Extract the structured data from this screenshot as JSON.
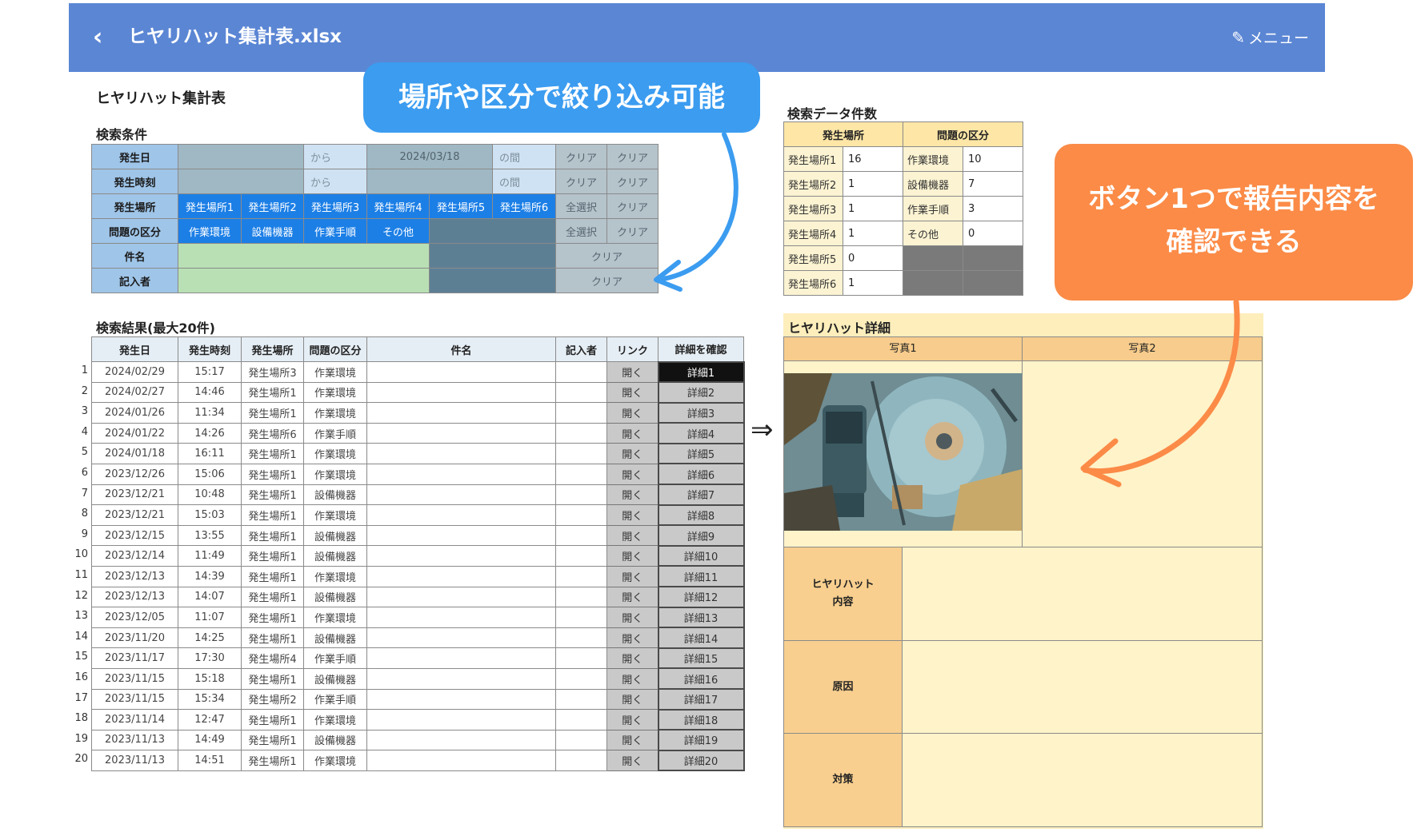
{
  "header": {
    "title": "ヒヤリハット集計表.xlsx",
    "menu_label": "メニュー"
  },
  "sheet": {
    "title": "ヒヤリハット集計表"
  },
  "search": {
    "section_label": "検索条件",
    "rows": {
      "date": {
        "label": "発生日",
        "from": "から",
        "to_value": "2024/03/18",
        "between": "の間",
        "clear1": "クリア",
        "clear2": "クリア"
      },
      "time": {
        "label": "発生時刻",
        "from": "から",
        "between": "の間",
        "clear1": "クリア",
        "clear2": "クリア"
      },
      "place": {
        "label": "発生場所",
        "buttons": [
          "発生場所1",
          "発生場所2",
          "発生場所3",
          "発生場所4",
          "発生場所5",
          "発生場所6"
        ],
        "select_all": "全選択",
        "clear": "クリア"
      },
      "category": {
        "label": "問題の区分",
        "buttons": [
          "作業環境",
          "設備機器",
          "作業手順",
          "その他"
        ],
        "select_all": "全選択",
        "clear": "クリア"
      },
      "subject": {
        "label": "件名",
        "clear": "クリア"
      },
      "author": {
        "label": "記入者",
        "clear": "クリア"
      }
    }
  },
  "counts": {
    "section_label": "検索データ件数",
    "headers": [
      "発生場所",
      "問題の区分"
    ],
    "places": [
      {
        "name": "発生場所1",
        "count": "16"
      },
      {
        "name": "発生場所2",
        "count": "1"
      },
      {
        "name": "発生場所3",
        "count": "1"
      },
      {
        "name": "発生場所4",
        "count": "1"
      },
      {
        "name": "発生場所5",
        "count": "0"
      },
      {
        "name": "発生場所6",
        "count": "1"
      }
    ],
    "categories": [
      {
        "name": "作業環境",
        "count": "10"
      },
      {
        "name": "設備機器",
        "count": "7"
      },
      {
        "name": "作業手順",
        "count": "3"
      },
      {
        "name": "その他",
        "count": "0"
      }
    ]
  },
  "results": {
    "section_label": "検索結果(最大20件)",
    "headers": [
      "発生日",
      "発生時刻",
      "発生場所",
      "問題の区分",
      "件名",
      "記入者",
      "リンク",
      "詳細を確認"
    ],
    "open_label": "開く",
    "rows": [
      {
        "no": "1",
        "date": "2024/02/29",
        "time": "15:17",
        "place": "発生場所3",
        "category": "作業環境",
        "detail": "詳細1"
      },
      {
        "no": "2",
        "date": "2024/02/27",
        "time": "14:46",
        "place": "発生場所1",
        "category": "作業環境",
        "detail": "詳細2"
      },
      {
        "no": "3",
        "date": "2024/01/26",
        "time": "11:34",
        "place": "発生場所1",
        "category": "作業環境",
        "detail": "詳細3"
      },
      {
        "no": "4",
        "date": "2024/01/22",
        "time": "14:26",
        "place": "発生場所6",
        "category": "作業手順",
        "detail": "詳細4"
      },
      {
        "no": "5",
        "date": "2024/01/18",
        "time": "16:11",
        "place": "発生場所1",
        "category": "作業環境",
        "detail": "詳細5"
      },
      {
        "no": "6",
        "date": "2023/12/26",
        "time": "15:06",
        "place": "発生場所1",
        "category": "作業環境",
        "detail": "詳細6"
      },
      {
        "no": "7",
        "date": "2023/12/21",
        "time": "10:48",
        "place": "発生場所1",
        "category": "設備機器",
        "detail": "詳細7"
      },
      {
        "no": "8",
        "date": "2023/12/21",
        "time": "15:03",
        "place": "発生場所1",
        "category": "作業環境",
        "detail": "詳細8"
      },
      {
        "no": "9",
        "date": "2023/12/15",
        "time": "13:55",
        "place": "発生場所1",
        "category": "設備機器",
        "detail": "詳細9"
      },
      {
        "no": "10",
        "date": "2023/12/14",
        "time": "11:49",
        "place": "発生場所1",
        "category": "設備機器",
        "detail": "詳細10"
      },
      {
        "no": "11",
        "date": "2023/12/13",
        "time": "14:39",
        "place": "発生場所1",
        "category": "作業環境",
        "detail": "詳細11"
      },
      {
        "no": "12",
        "date": "2023/12/13",
        "time": "14:07",
        "place": "発生場所1",
        "category": "設備機器",
        "detail": "詳細12"
      },
      {
        "no": "13",
        "date": "2023/12/05",
        "time": "11:07",
        "place": "発生場所1",
        "category": "作業環境",
        "detail": "詳細13"
      },
      {
        "no": "14",
        "date": "2023/11/20",
        "time": "14:25",
        "place": "発生場所1",
        "category": "設備機器",
        "detail": "詳細14"
      },
      {
        "no": "15",
        "date": "2023/11/17",
        "time": "17:30",
        "place": "発生場所4",
        "category": "作業手順",
        "detail": "詳細15"
      },
      {
        "no": "16",
        "date": "2023/11/15",
        "time": "15:18",
        "place": "発生場所1",
        "category": "設備機器",
        "detail": "詳細16"
      },
      {
        "no": "17",
        "date": "2023/11/15",
        "time": "15:34",
        "place": "発生場所2",
        "category": "作業手順",
        "detail": "詳細17"
      },
      {
        "no": "18",
        "date": "2023/11/14",
        "time": "12:47",
        "place": "発生場所1",
        "category": "作業環境",
        "detail": "詳細18"
      },
      {
        "no": "19",
        "date": "2023/11/13",
        "time": "14:49",
        "place": "発生場所1",
        "category": "設備機器",
        "detail": "詳細19"
      },
      {
        "no": "20",
        "date": "2023/11/13",
        "time": "14:51",
        "place": "発生場所1",
        "category": "作業環境",
        "detail": "詳細20"
      }
    ]
  },
  "arrow_symbol": "⇒",
  "detail": {
    "section_label": "ヒヤリハット詳細",
    "photo1": "写真1",
    "photo2": "写真2",
    "content_label_1": "ヒヤリハット",
    "content_label_2": "内容",
    "cause_label": "原因",
    "measure_label": "対策"
  },
  "callouts": {
    "blue": "場所や区分で絞り込み可能",
    "orange_line1": "ボタン1つで報告内容を",
    "orange_line2": "確認できる"
  }
}
